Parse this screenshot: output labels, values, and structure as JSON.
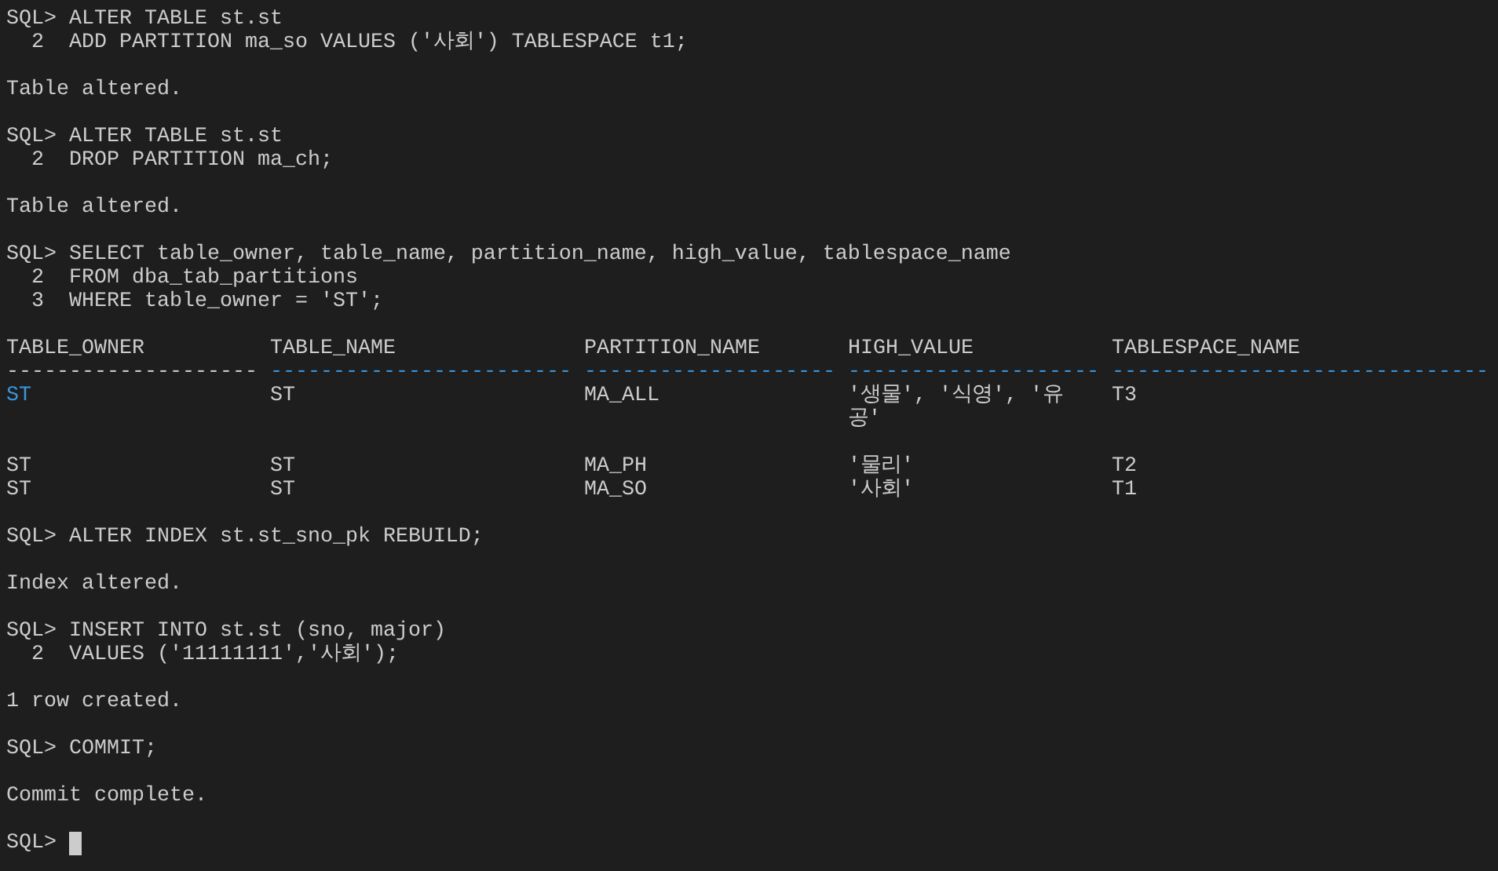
{
  "terminal": {
    "lines": [
      {
        "kind": "text",
        "text": "SQL> ALTER TABLE st.st"
      },
      {
        "kind": "text",
        "text": "  2  ADD PARTITION ma_so VALUES ('사회') TABLESPACE t1;"
      },
      {
        "kind": "gap"
      },
      {
        "kind": "text",
        "text": "Table altered."
      },
      {
        "kind": "gap"
      },
      {
        "kind": "text",
        "text": "SQL> ALTER TABLE st.st"
      },
      {
        "kind": "text",
        "text": "  2  DROP PARTITION ma_ch;"
      },
      {
        "kind": "gap"
      },
      {
        "kind": "text",
        "text": "Table altered."
      },
      {
        "kind": "gap"
      },
      {
        "kind": "text",
        "text": "SQL> SELECT table_owner, table_name, partition_name, high_value, tablespace_name"
      },
      {
        "kind": "text",
        "text": "  2  FROM dba_tab_partitions"
      },
      {
        "kind": "text",
        "text": "  3  WHERE table_owner = 'ST';"
      },
      {
        "kind": "gap"
      },
      {
        "kind": "table",
        "columns": [
          {
            "heading": "TABLE_OWNER",
            "rule": "--------------------",
            "color": "#cccccc"
          },
          {
            "heading": "TABLE_NAME",
            "rule": "------------------------",
            "color": "#3a96dd"
          },
          {
            "heading": "PARTITION_NAME",
            "rule": "--------------------",
            "color": "#3a96dd"
          },
          {
            "heading": "HIGH_VALUE",
            "rule": "--------------------",
            "color": "#3a96dd"
          },
          {
            "heading": "TABLESPACE_NAME",
            "rule": "------------------------------",
            "color": "#3a96dd"
          }
        ],
        "rows": [
          {
            "blank_line_after": true,
            "cells": [
              {
                "lines": [
                  "ST"
                ],
                "color": "#3a96dd"
              },
              {
                "lines": [
                  "ST"
                ],
                "color": "#cccccc"
              },
              {
                "lines": [
                  "MA_ALL"
                ],
                "color": "#cccccc"
              },
              {
                "lines": [
                  "'생물', '식영', '유",
                  "공'"
                ],
                "color": "#cccccc"
              },
              {
                "lines": [
                  "T3"
                ],
                "color": "#cccccc"
              }
            ]
          },
          {
            "blank_line_after": false,
            "cells": [
              {
                "lines": [
                  "ST"
                ],
                "color": "#cccccc"
              },
              {
                "lines": [
                  "ST"
                ],
                "color": "#cccccc"
              },
              {
                "lines": [
                  "MA_PH"
                ],
                "color": "#cccccc"
              },
              {
                "lines": [
                  "'물리'"
                ],
                "color": "#cccccc"
              },
              {
                "lines": [
                  "T2"
                ],
                "color": "#cccccc"
              }
            ]
          },
          {
            "blank_line_after": true,
            "cells": [
              {
                "lines": [
                  "ST"
                ],
                "color": "#cccccc"
              },
              {
                "lines": [
                  "ST"
                ],
                "color": "#cccccc"
              },
              {
                "lines": [
                  "MA_SO"
                ],
                "color": "#cccccc"
              },
              {
                "lines": [
                  "'사회'"
                ],
                "color": "#cccccc"
              },
              {
                "lines": [
                  "T1"
                ],
                "color": "#cccccc"
              }
            ]
          }
        ]
      },
      {
        "kind": "text",
        "text": "SQL> ALTER INDEX st.st_sno_pk REBUILD;"
      },
      {
        "kind": "gap"
      },
      {
        "kind": "text",
        "text": "Index altered."
      },
      {
        "kind": "gap"
      },
      {
        "kind": "text",
        "text": "SQL> INSERT INTO st.st (sno, major)"
      },
      {
        "kind": "text",
        "text": "  2  VALUES ('11111111','사회');"
      },
      {
        "kind": "gap"
      },
      {
        "kind": "text",
        "text": "1 row created."
      },
      {
        "kind": "gap"
      },
      {
        "kind": "text",
        "text": "SQL> COMMIT;"
      },
      {
        "kind": "gap"
      },
      {
        "kind": "text",
        "text": "Commit complete."
      },
      {
        "kind": "gap"
      },
      {
        "kind": "prompt",
        "text": "SQL>"
      }
    ]
  }
}
